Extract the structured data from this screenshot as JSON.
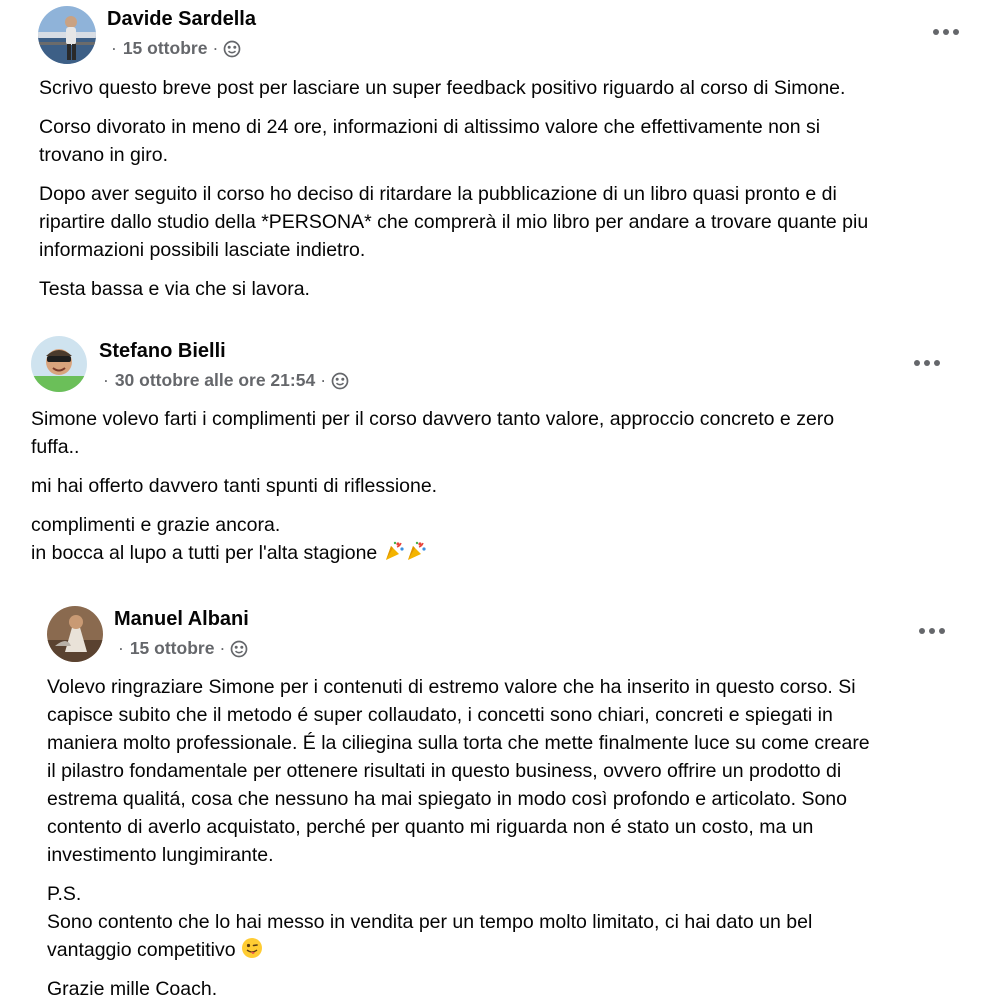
{
  "posts": [
    {
      "author": "Davide Sardella",
      "date": "15 ottobre",
      "privacy_icon": "globe-icon",
      "menu_icon": "more-options-icon",
      "paragraphs": [
        "Scrivo questo breve post per lasciare un super feedback positivo riguardo al corso di Simone.",
        "Corso divorato in meno di 24 ore, informazioni di altissimo valore che effettivamente non si\ntrovano in giro.",
        "Dopo aver seguito il corso ho deciso di ritardare la pubblicazione di un libro quasi pronto e di\nripartire dallo studio della *PERSONA* che comprerà il mio libro per andare a trovare quante piu\ninformazioni possibili lasciate indietro.",
        "Testa bassa e via che si lavora."
      ]
    },
    {
      "author": "Stefano Bielli",
      "date": "30 ottobre alle ore 21:54",
      "privacy_icon": "globe-icon",
      "menu_icon": "more-options-icon",
      "paragraphs": [
        "Simone volevo farti i  complimenti per il corso davvero tanto valore, approccio concreto e zero\nfuffa..",
        "mi hai offerto davvero tanti spunti di riflessione.",
        "complimenti e grazie ancora.\n in bocca al lupo a tutti per l'alta stagione"
      ],
      "trailing_emoji": "party-popper-emoji party-popper-emoji"
    },
    {
      "author": "Manuel Albani",
      "date": "15 ottobre",
      "privacy_icon": "globe-icon",
      "menu_icon": "more-options-icon",
      "paragraphs": [
        "Volevo ringraziare Simone per i contenuti di estremo valore che ha inserito in questo corso. Si\ncapisce subito che il metodo é super collaudato, i concetti sono chiari, concreti e spiegati in\nmaniera molto professionale. É la ciliegina sulla torta che mette finalmente luce su come creare\nil pilastro fondamentale per ottenere risultati in questo business, ovvero offrire un prodotto di\nestrema qualitá, cosa che nessuno ha mai spiegato in modo così profondo e articolato. Sono\ncontento di averlo acquistato, perché per quanto mi riguarda non é stato un costo, ma un\ninvestimento lungimirante.",
        "P.S.\nSono contento che lo hai messo in vendita per un tempo molto limitato, ci hai dato un bel\nvantaggio competitivo",
        "Grazie mille Coach."
      ],
      "trailing_emoji": "winking-tongue-face-emoji"
    }
  ],
  "colors": {
    "text": "#050505",
    "secondary_text": "#65676b",
    "background": "#ffffff"
  }
}
